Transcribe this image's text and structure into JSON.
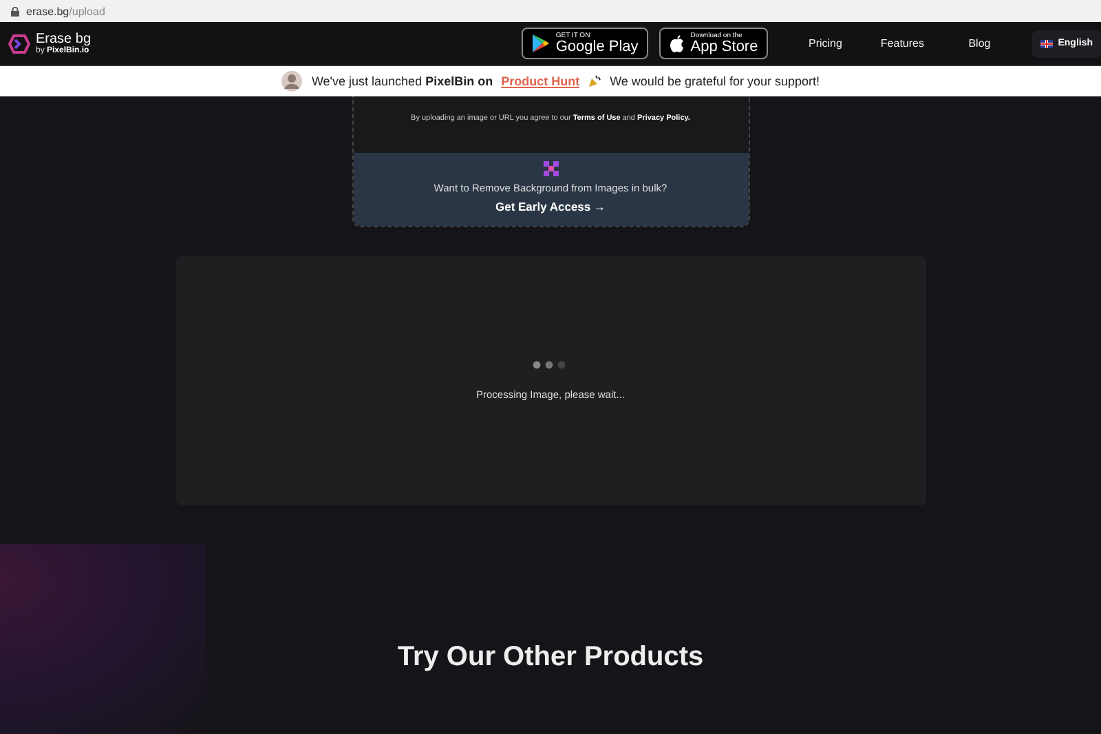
{
  "browser": {
    "url_host": "erase.bg",
    "url_path": "/upload"
  },
  "header": {
    "logo_title": "Erase bg",
    "logo_subtitle_prefix": "by",
    "logo_subtitle_brand": "PixelBin.io",
    "store_badges": [
      {
        "kind": "google",
        "small": "GET IT ON",
        "big": "Google Play"
      },
      {
        "kind": "apple",
        "small": "Download on the",
        "big": "App Store"
      }
    ],
    "nav": [
      "Pricing",
      "Features",
      "Blog"
    ],
    "language": "English"
  },
  "banner": {
    "text": "We've just launched **PixelBin on**",
    "link": "Product Hunt",
    "tail": "We would be grateful for your support!"
  },
  "upload_card": {
    "terms": "By uploading an image or URL you agree to our **Terms of Use** and **Privacy Policy.**",
    "bulk_text": "Want to Remove Background from Images in bulk?",
    "bulk_cta": "Get Early Access →"
  },
  "processing": {
    "message": "Processing Image, please wait..."
  },
  "products": {
    "heading": "Try Our Other Products"
  }
}
